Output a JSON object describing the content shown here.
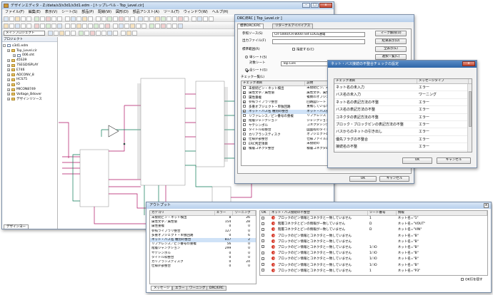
{
  "main_window": {
    "title": "デザインエディタ - Z:/data/s3/s3d1/s3d1.edm - [トップレベル - Top_Level.cir]",
    "menu": [
      "ファイル(F)",
      "編集(E)",
      "表示(V)",
      "シート(S)",
      "部品(P)",
      "配線(W)",
      "図形(D)",
      "部品アシスト(A)",
      "ツール(T)",
      "ウィンドウ(W)",
      "ヘルプ(H)"
    ],
    "project_selector": "メインプロジェクト",
    "sidebar_title": "プロジェクト",
    "tree": {
      "root": "s3d1.edm",
      "items": [
        "Top_Level.cir",
        "006.sht",
        "45S39",
        "7SEGDISPLAY",
        "E746",
        "ADCONV_8",
        "HCS75",
        "IO",
        "MICON8749",
        "Voltage_Bdover",
        "デザインリソース"
      ]
    },
    "bottom_tab": "デザインヨー"
  },
  "drc_dialog": {
    "title": "DRC/ERC [ Top_Level.cir ]",
    "tabs": [
      "標準DRC/ERC",
      "リターナルアイバイアス"
    ],
    "ref_source_label": "参照ソース(S)",
    "ref_source_value": "CR-5000/CR-8000 net LOGS通電",
    "output_file_label": "出力ファイル(F)",
    "scope_label": "標準範囲(R)",
    "scope_option": "指定する(C)",
    "sheet_option": "単シート(S)",
    "target_sheet_label": "対象シート",
    "target_sheet_value": "Top Lvls",
    "all_sheets_option": "全シート(G)",
    "buttons": [
      "マーク解除(U)",
      "結果表示(D)",
      "全表示(E)",
      "選択一覧(C)"
    ],
    "check_list_label": "チェック一覧(L)",
    "check_headers": [
      "チェック項目",
      "説明"
    ],
    "check_rows": [
      [
        "未接続ピン・ネット検出",
        "未接続ピン、未接続ネットを検出"
      ],
      [
        "属性文字／属性値",
        "属性文字、属性値を検出"
      ],
      [
        "属性重複",
        "複数のオブジェクト同名属性"
      ],
      [
        "参照ライブラリ整合",
        "回路図シート の部品"
      ],
      [
        "多重オブジェクト・単独回路",
        "重複しているオブジェクト"
      ],
      [
        "ネット・バス名 種別の整合",
        "ネット・バス名の整合"
      ],
      [
        "リファレンス／ピン番号の重複",
        "リファレンス・ピン番号"
      ],
      [
        "階層ジャンクション",
        "ジャンクション"
      ],
      [
        "ヤテシンボル",
        "コネクタシンボルの整合"
      ],
      [
        "タイトル枠整合",
        "図面枠のタイトル"
      ],
      [
        "カリアランスティスク",
        "オブジェクトの重なり"
      ],
      [
        "仕様外部整合",
        "仕様ファイルと部品"
      ],
      [
        "ERC判定項目",
        "未接続の"
      ],
      [
        "積層コネクタ整合",
        "積層コネクタの整合"
      ]
    ],
    "ok": "OK",
    "cancel": "キャンセル"
  },
  "net_dialog": {
    "title": "ネット・バス接続の不整合チェックの設定",
    "headers": [
      "チェック項目",
      "メッセージタイプ"
    ],
    "rows": [
      [
        "ネット名の未入力",
        "エラー"
      ],
      [
        "バス名の未入力",
        "ワーニング"
      ],
      [
        "ネット名の表記方法の不整",
        "エラー"
      ],
      [
        "バス名の表記方法の不整",
        "エラー"
      ],
      [
        "コネクタの表記方法の不整",
        "エラー"
      ],
      [
        "ブロック・ブロックピンの表記方法の不整",
        "エラー"
      ],
      [
        "バスからのネットの引き出し",
        "エラー"
      ],
      [
        "優先フラグの不整合",
        "エラー"
      ],
      [
        "接続名の不整",
        "エラー"
      ]
    ],
    "ok": "OK",
    "cancel": "キャンセル"
  },
  "output_window": {
    "title": "アウトプット",
    "summary_headers": [
      "カテゴリ",
      "エラー",
      "ワーニング"
    ],
    "summary_rows": [
      [
        "未接続ピン・ネット検出",
        "8",
        "26"
      ],
      [
        "属性文字／属性値",
        "154",
        "28"
      ],
      [
        "属性重複",
        "0",
        "0"
      ],
      [
        "参照ライブラリ整合",
        "127",
        "0"
      ],
      [
        "多重オブジェクト・単独回路",
        "0",
        "6"
      ],
      [
        "ネット・バス名 種別の整合",
        "817",
        "2"
      ],
      [
        "リファレンス／ピン番号の重複",
        "56",
        "0"
      ],
      [
        "階層ジャンクション",
        "299",
        "0"
      ],
      [
        "ヤテシンボル",
        "0",
        "0"
      ],
      [
        "タイトル枠整合",
        "0",
        "0"
      ],
      [
        "カリアランスティスク",
        "0",
        "24"
      ],
      [
        "仕様外部整合",
        "0",
        "0"
      ]
    ],
    "detail_headers": [
      "OK",
      "ネット・バス接続の不整合",
      "シート番号",
      "情報"
    ],
    "detail_rows": [
      [
        "ブロックのピン情報とコネクタと一致していません",
        "1",
        "ネット名=\"1\""
      ],
      [
        "階層コネクタとピンの情報が一致していません",
        "D",
        "ネット名=\"VOUT\""
      ],
      [
        "階層コネクタとピンの情報が一致していません",
        "D",
        "ネット名=\"VIN\""
      ],
      [
        "ブロックのピン情報とコネクタと一致していません",
        "",
        "ネット名=\"B\""
      ],
      [
        "ブロックのピン情報とコネクタと一致していません",
        "",
        "ネット名=\"B\""
      ],
      [
        "ブロックのピン情報とコネクタと一致していません",
        "1/ IO",
        "ネット名=\"B\""
      ],
      [
        "ブロックのピン情報とコネクタと一致していません",
        "1/ IO",
        "ネット名=\"B\""
      ],
      [
        "ブロックのピン情報とコネクタと一致していません",
        "1/ IO",
        "ネット名=\"B\""
      ],
      [
        "ブロックのピン情報とコネクタと一致していません",
        "1/ IO",
        "ネット名=\"B\""
      ],
      [
        "ブロックのピン情報とコネクタと一致していません",
        "1",
        "ネット名=\"P3\""
      ]
    ],
    "ok_hide": "OK行を隠す",
    "tabs": [
      "メッセージ",
      "エラー",
      "ワーニング",
      "DRC/ERC"
    ]
  }
}
